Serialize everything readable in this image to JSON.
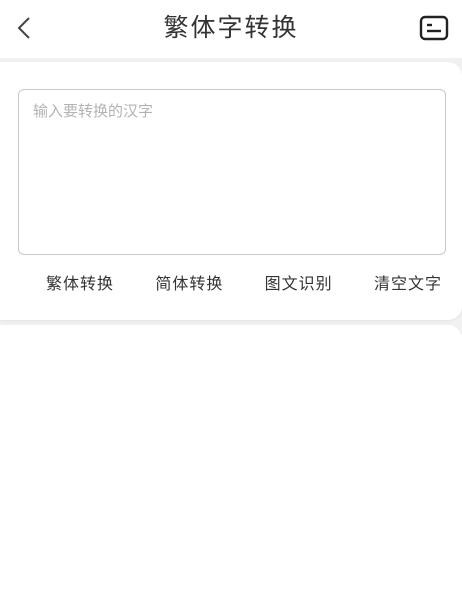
{
  "header": {
    "title": "繁体字转换",
    "back_icon": "chevron-left-icon",
    "menu_icon": "document-list-icon"
  },
  "input": {
    "placeholder": "输入要转换的汉字",
    "value": ""
  },
  "actions": [
    {
      "label": "繁体转换"
    },
    {
      "label": "简体转换"
    },
    {
      "label": "图文识别"
    },
    {
      "label": "清空文字"
    }
  ],
  "colors": {
    "background": "#f1f1f1",
    "surface": "#ffffff",
    "text": "#333333",
    "placeholder": "#b3b3b3",
    "border": "#c9c9c9"
  }
}
